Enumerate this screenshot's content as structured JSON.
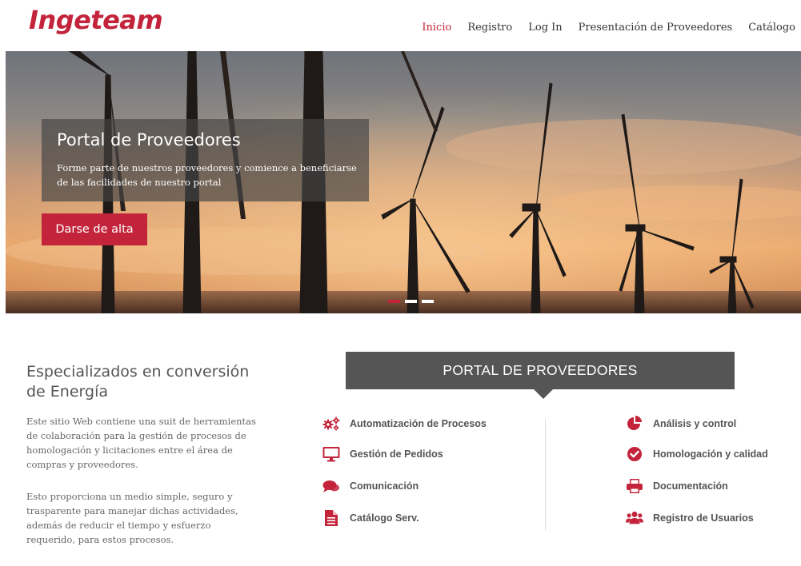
{
  "brand": {
    "name": "Ingeteam",
    "color": "#c3243b"
  },
  "nav": {
    "items": [
      {
        "label": "Inicio",
        "active": true
      },
      {
        "label": "Registro",
        "active": false
      },
      {
        "label": "Log In",
        "active": false
      },
      {
        "label": "Presentación de Proveedores",
        "active": false
      },
      {
        "label": "Catálogo",
        "active": false
      }
    ]
  },
  "hero": {
    "title": "Portal de Proveedores",
    "text": "Forme parte de nuestros proveedores y comience a beneficiarse de las facilidades de nuestro portal",
    "button_label": "Darse de alta",
    "slides": {
      "count": 3,
      "active_index": 0
    }
  },
  "intro": {
    "heading": "Especializados en conversión de Energía",
    "paragraph1": "Este sitio Web contiene una suit de herramientas de colaboración para la gestión de procesos de homologación y licitaciones entre el área de compras y proveedores.",
    "paragraph2": "Esto proporciona un medio simple, seguro y trasparente para manejar dichas actividades, además de reducir el tiempo y esfuerzo requerido, para estos procesos."
  },
  "portal": {
    "title": "PORTAL DE PROVEEDORES",
    "left_features": [
      {
        "label": "Automatización de Procesos",
        "icon": "gears-icon"
      },
      {
        "label": "Gestión de Pedidos",
        "icon": "monitor-icon"
      },
      {
        "label": "Comunicación",
        "icon": "comments-icon"
      },
      {
        "label": "Catálogo Serv.",
        "icon": "file-text-icon"
      }
    ],
    "right_features": [
      {
        "label": "Análisis y control",
        "icon": "pie-chart-icon"
      },
      {
        "label": "Homologación y calidad",
        "icon": "check-circle-icon"
      },
      {
        "label": "Documentación",
        "icon": "print-icon"
      },
      {
        "label": "Registro de Usuarios",
        "icon": "users-icon"
      }
    ]
  }
}
